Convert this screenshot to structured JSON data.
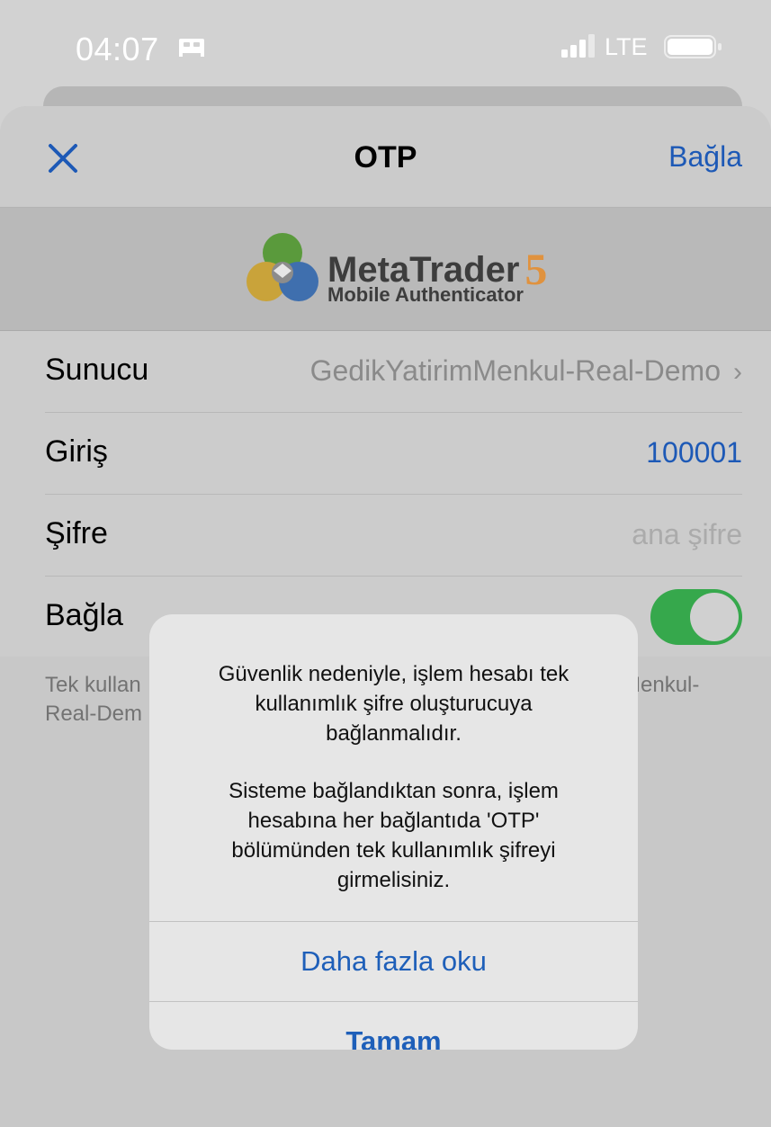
{
  "status_bar": {
    "time": "04:07",
    "network": "LTE",
    "icons": [
      "bed-icon",
      "signal-icon",
      "battery-icon"
    ]
  },
  "nav": {
    "close_icon": "close-icon",
    "title": "OTP",
    "connect_label": "Bağla"
  },
  "logo": {
    "brand": "MetaTrader",
    "version": "5",
    "subtitle": "Mobile Authenticator"
  },
  "form": {
    "server": {
      "label": "Sunucu",
      "value": "GedikYatirimMenkul-Real-Demo",
      "chevron": "›"
    },
    "login": {
      "label": "Giriş",
      "value": "100001"
    },
    "password": {
      "label": "Şifre",
      "placeholder": "ana şifre"
    },
    "connect": {
      "label": "Bağla",
      "enabled": true
    }
  },
  "footer_note": {
    "left_line1": "Tek kullan",
    "left_line2": "Real-Dem",
    "right_line1": "Menkul-"
  },
  "alert": {
    "message1_lines": [
      "Güvenlik nedeniyle, işlem hesabı tek",
      "kullanımlık şifre oluşturucuya",
      "bağlanmalıdır."
    ],
    "message2_lines": [
      "Sisteme bağlandıktan sonra, işlem",
      "hesabına her bağlantıda 'OTP'",
      "bölümünden tek kullanımlık şifreyi",
      "girmelisiniz."
    ],
    "more_button": "Daha fazla oku",
    "ok_button": "Tamam"
  },
  "colors": {
    "accent": "#1d59b6",
    "toggle_on": "#36a84c",
    "logo_five": "#e0923e",
    "background": "#d2d2d2"
  }
}
